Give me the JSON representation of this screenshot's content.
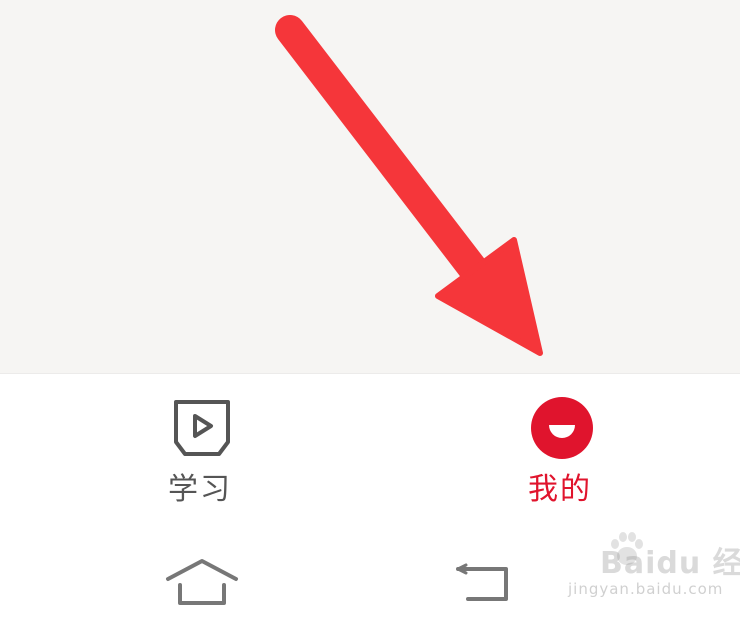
{
  "colors": {
    "content_background": "#f6f5f3",
    "annotation_arrow": "#f5363a",
    "tab_active": "#e0142d",
    "tab_inactive": "#555555",
    "nav_icon": "#777777"
  },
  "tabs": [
    {
      "label": "学习",
      "icon": "play-video-icon",
      "active": false
    },
    {
      "label": "我的",
      "icon": "smile-face-icon",
      "active": true
    }
  ],
  "system_nav": [
    {
      "icon": "home-icon"
    },
    {
      "icon": "back-icon"
    }
  ],
  "watermark": {
    "brand": "Baidu 经验",
    "url": "jingyan.baidu.com"
  }
}
